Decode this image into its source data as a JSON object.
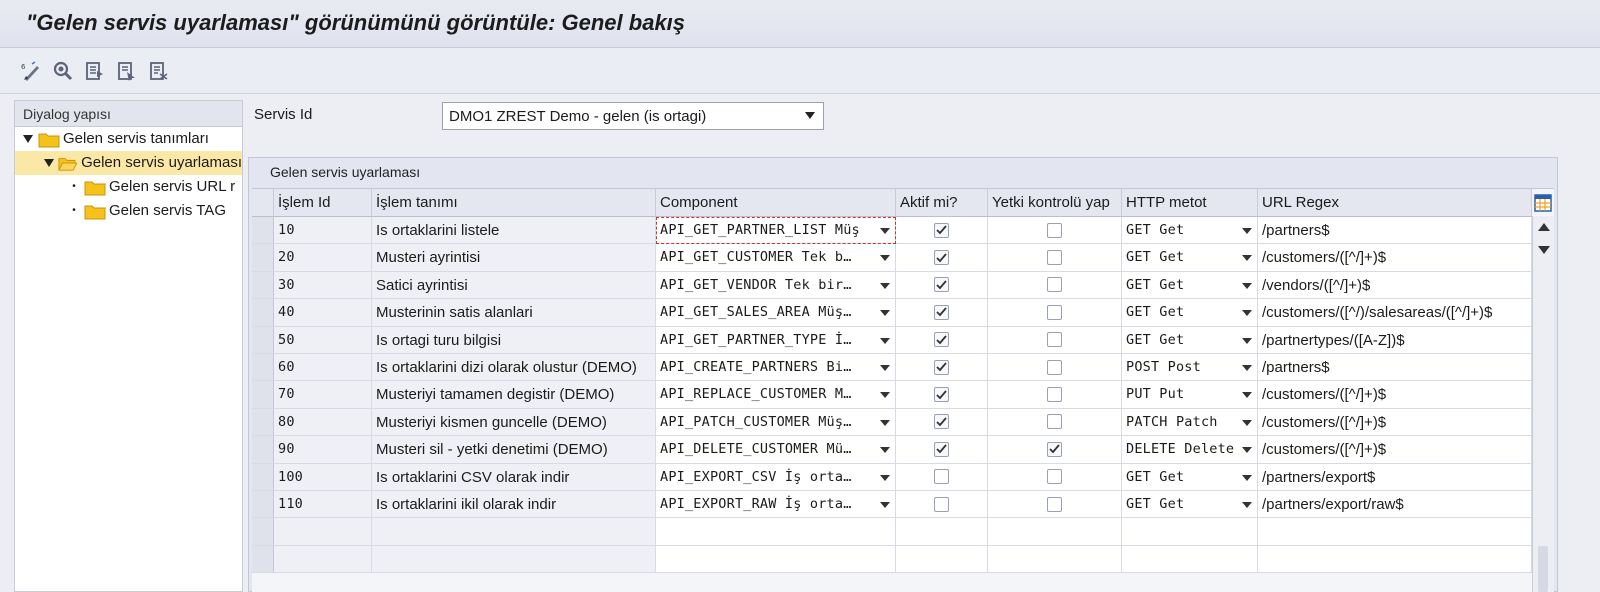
{
  "window": {
    "title": "\"Gelen servis uyarlaması\" görünümünü görüntüle: Genel bakış"
  },
  "toolbar": {
    "buttons": [
      {
        "name": "display-change-icon"
      },
      {
        "name": "find-icon"
      },
      {
        "name": "select-all-icon"
      },
      {
        "name": "select-block-icon"
      },
      {
        "name": "deselect-all-icon"
      }
    ]
  },
  "tree": {
    "header": "Diyalog yapısı",
    "items": [
      {
        "label": "Gelen servis tanımları",
        "level": 0,
        "expanded": true
      },
      {
        "label": "Gelen servis uyarlaması",
        "level": 1,
        "expanded": true,
        "selected": true
      },
      {
        "label": "Gelen servis URL r",
        "level": 2
      },
      {
        "label": "Gelen servis TAG",
        "level": 2
      }
    ]
  },
  "servis": {
    "label": "Servis Id",
    "value": "DMO1 ZREST Demo - gelen (is ortagi)"
  },
  "panel": {
    "title": "Gelen servis uyarlaması"
  },
  "table": {
    "columns": [
      "İşlem Id",
      "İşlem tanımı",
      "Component",
      "Aktif mi?",
      "Yetki kontrolü yap",
      "HTTP metot",
      "URL Regex"
    ],
    "rows": [
      {
        "id": "10",
        "desc": "Is ortaklarini listele",
        "component": "API_GET_PARTNER_LIST Müş",
        "active": true,
        "auth": false,
        "method": "GET Get",
        "regex": "/partners$"
      },
      {
        "id": "20",
        "desc": "Musteri ayrintisi",
        "component": "API_GET_CUSTOMER Tek b…",
        "active": true,
        "auth": false,
        "method": "GET Get",
        "regex": "/customers/([^/]+)$"
      },
      {
        "id": "30",
        "desc": "Satici ayrintisi",
        "component": "API_GET_VENDOR Tek bir…",
        "active": true,
        "auth": false,
        "method": "GET Get",
        "regex": "/vendors/([^/]+)$"
      },
      {
        "id": "40",
        "desc": "Musterinin satis alanlari",
        "component": "API_GET_SALES_AREA Müş…",
        "active": true,
        "auth": false,
        "method": "GET Get",
        "regex": "/customers/([^/)/salesareas/([^/]+)$"
      },
      {
        "id": "50",
        "desc": "Is ortagi turu bilgisi",
        "component": "API_GET_PARTNER_TYPE İ…",
        "active": true,
        "auth": false,
        "method": "GET Get",
        "regex": "/partnertypes/([A-Z])$"
      },
      {
        "id": "60",
        "desc": "Is ortaklarini dizi olarak olustur (DEMO)",
        "component": "API_CREATE_PARTNERS Bi…",
        "active": true,
        "auth": false,
        "method": "POST Post",
        "regex": "/partners$"
      },
      {
        "id": "70",
        "desc": "Musteriyi tamamen degistir (DEMO)",
        "component": "API_REPLACE_CUSTOMER M…",
        "active": true,
        "auth": false,
        "method": "PUT Put",
        "regex": "/customers/([^/]+)$"
      },
      {
        "id": "80",
        "desc": "Musteriyi kismen guncelle (DEMO)",
        "component": "API_PATCH_CUSTOMER Müş…",
        "active": true,
        "auth": false,
        "method": "PATCH Patch",
        "regex": "/customers/([^/]+)$"
      },
      {
        "id": "90",
        "desc": "Musteri sil - yetki denetimi (DEMO)",
        "component": "API_DELETE_CUSTOMER Mü…",
        "active": true,
        "auth": true,
        "method": "DELETE Delete",
        "regex": "/customers/([^/]+)$"
      },
      {
        "id": "100",
        "desc": "Is ortaklarini CSV olarak indir",
        "component": "API_EXPORT_CSV İş orta…",
        "active": false,
        "auth": false,
        "method": "GET Get",
        "regex": "/partners/export$"
      },
      {
        "id": "110",
        "desc": "Is ortaklarini ikil olarak indir",
        "component": "API_EXPORT_RAW İş orta…",
        "active": false,
        "auth": false,
        "method": "GET Get",
        "regex": "/partners/export/raw$"
      }
    ],
    "empty_rows": 2
  },
  "colors": {
    "row_selected_tree": "#fbe7a6",
    "folder": "#f5c21b",
    "focus_outline": "#c0392b"
  }
}
